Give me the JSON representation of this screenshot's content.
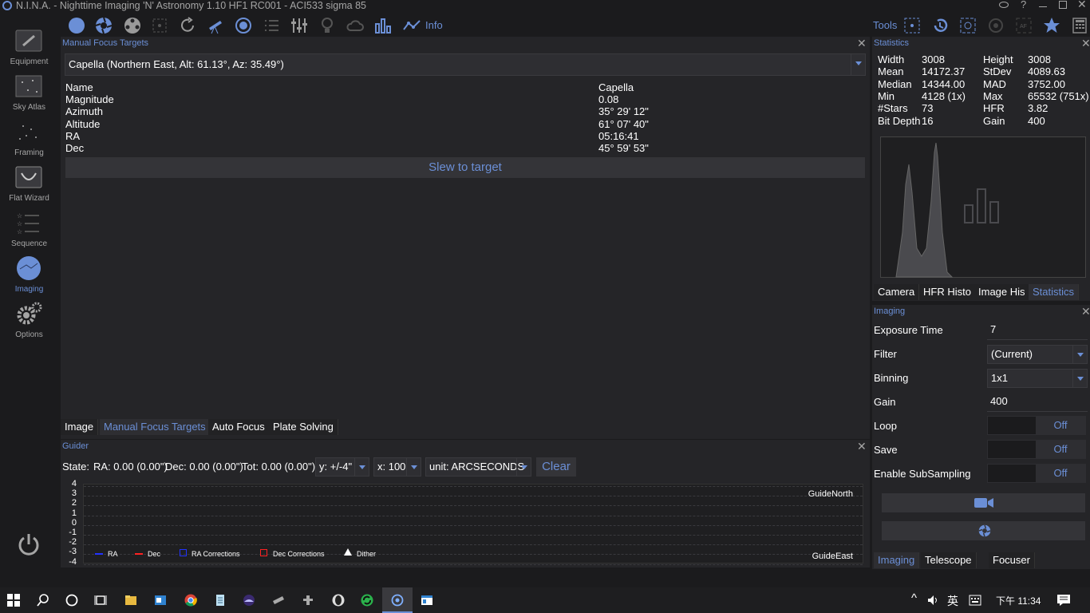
{
  "window": {
    "title": "N.I.N.A. - Nighttime Imaging 'N' Astronomy 1.10 HF1 RC001  -  ACI533 sigma 85"
  },
  "sidebar": {
    "items": [
      {
        "label": "Equipment"
      },
      {
        "label": "Sky Atlas"
      },
      {
        "label": "Framing"
      },
      {
        "label": "Flat Wizard"
      },
      {
        "label": "Sequence"
      },
      {
        "label": "Imaging"
      },
      {
        "label": "Options"
      }
    ]
  },
  "toolbar": {
    "info_label": "Info",
    "tools_label": "Tools"
  },
  "focus_targets": {
    "header": "Manual Focus Targets",
    "selected": "Capella (Northern East, Alt: 61.13°, Az: 35.49°)",
    "props": [
      {
        "label": "Name",
        "value": "Capella"
      },
      {
        "label": "Magnitude",
        "value": "0.08"
      },
      {
        "label": "Azimuth",
        "value": "35° 29' 12\""
      },
      {
        "label": "Altitude",
        "value": "61° 07' 40\""
      },
      {
        "label": "RA",
        "value": "05:16:41"
      },
      {
        "label": "Dec",
        "value": "45° 59' 53\""
      }
    ],
    "slew_label": "Slew to target"
  },
  "main_tabs": [
    "Image",
    "Manual Focus Targets",
    "Auto Focus",
    "Plate Solving"
  ],
  "guider": {
    "header": "Guider",
    "state_label": "State:",
    "ra": "RA: 0.00 (0.00\")",
    "dec": "Dec: 0.00 (0.00\")",
    "tot": "Tot: 0.00 (0.00\")",
    "y_scale": "y: +/-4\"",
    "x_scale": "x: 100",
    "unit": "unit: ARCSECONDS",
    "clear_label": "Clear",
    "y_ticks": [
      "4",
      "3",
      "2",
      "1",
      "0",
      "-1",
      "-2",
      "-3",
      "-4"
    ],
    "north_label": "GuideNorth",
    "east_label": "GuideEast",
    "legend": [
      "RA",
      "Dec",
      "RA Corrections",
      "Dec Corrections",
      "Dither"
    ]
  },
  "statistics": {
    "header": "Statistics",
    "left": [
      {
        "label": "Width",
        "value": "3008"
      },
      {
        "label": "Mean",
        "value": "14172.37"
      },
      {
        "label": "Median",
        "value": "14344.00"
      },
      {
        "label": "Min",
        "value": "4128 (1x)"
      },
      {
        "label": "#Stars",
        "value": "73"
      },
      {
        "label": "Bit Depth",
        "value": "16"
      }
    ],
    "right": [
      {
        "label": "Height",
        "value": "3008"
      },
      {
        "label": "StDev",
        "value": "4089.63"
      },
      {
        "label": "MAD",
        "value": "3752.00"
      },
      {
        "label": "Max",
        "value": "65532 (751x)"
      },
      {
        "label": "HFR",
        "value": "3.82"
      },
      {
        "label": "Gain",
        "value": "400"
      }
    ],
    "tabs": [
      "Camera",
      "HFR Histo",
      "Image His",
      "Statistics"
    ]
  },
  "imaging": {
    "header": "Imaging",
    "exposure_label": "Exposure Time",
    "exposure_value": "7",
    "filter_label": "Filter",
    "filter_value": "(Current)",
    "binning_label": "Binning",
    "binning_value": "1x1",
    "gain_label": "Gain",
    "gain_value": "400",
    "loop_label": "Loop",
    "loop_state": "Off",
    "save_label": "Save",
    "save_state": "Off",
    "subsampling_label": "Enable SubSampling",
    "subsampling_state": "Off",
    "tabs": [
      "Imaging",
      "Telescope",
      "Focuser"
    ]
  },
  "taskbar": {
    "ime": "英",
    "time": "下午 11:34"
  },
  "colors": {
    "accent": "#6b8fd6",
    "panel": "#252528",
    "bg": "#1b1b1d"
  }
}
